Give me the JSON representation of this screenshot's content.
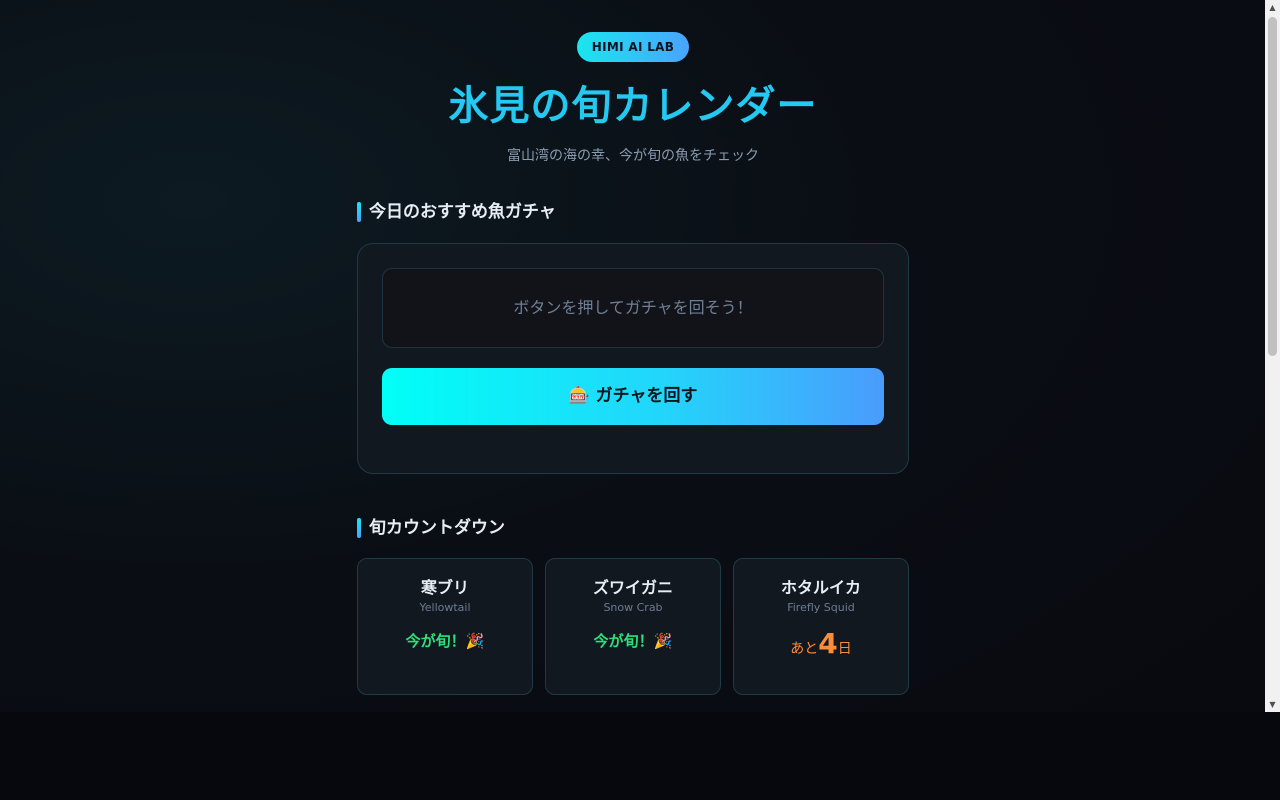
{
  "header": {
    "badge": "HIMI AI LAB",
    "title": "氷見の旬カレンダー",
    "subtitle": "富山湾の海の幸、今が旬の魚をチェック"
  },
  "gacha": {
    "section_title": "今日のおすすめ魚ガチャ",
    "display_text": "ボタンを押してガチャを回そう！",
    "button_icon": "🎰",
    "button_label": "ガチャを回す"
  },
  "countdown": {
    "section_title": "旬カウントダウン",
    "cards": [
      {
        "name": "寒ブリ",
        "english": "Yellowtail",
        "status": "今が旬！🎉"
      },
      {
        "name": "ズワイガニ",
        "english": "Snow Crab",
        "status": "今が旬！🎉"
      },
      {
        "name": "ホタルイカ",
        "english": "Firefly Squid",
        "prefix": "あと",
        "days": "4",
        "suffix": "日"
      }
    ]
  },
  "colors": {
    "accent_cyan": "#24c9f2",
    "in_season_green": "#2fe07a",
    "countdown_orange": "#ff8c3a"
  }
}
